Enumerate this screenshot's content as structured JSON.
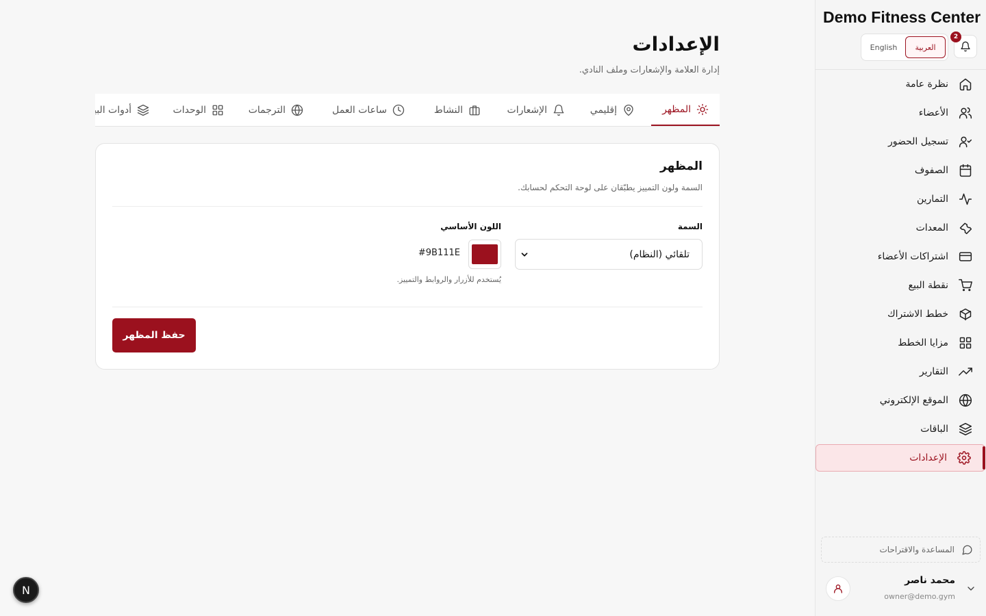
{
  "brand": {
    "name": "Demo Fitness Center"
  },
  "header": {
    "notifications_count": "2",
    "lang_arabic": "العربية",
    "lang_english": "English",
    "active_lang": "ar"
  },
  "sidebar": {
    "items": [
      {
        "label": "نظرة عامة",
        "icon": "home-icon"
      },
      {
        "label": "الأعضاء",
        "icon": "users-icon"
      },
      {
        "label": "تسجيل الحضور",
        "icon": "user-check-icon"
      },
      {
        "label": "الصفوف",
        "icon": "calendar-icon"
      },
      {
        "label": "التمارين",
        "icon": "activity-icon"
      },
      {
        "label": "المعدات",
        "icon": "wrench-icon"
      },
      {
        "label": "اشتراكات الأعضاء",
        "icon": "credit-card-icon"
      },
      {
        "label": "نقطة البيع",
        "icon": "cart-icon"
      },
      {
        "label": "خطط الاشتراك",
        "icon": "package-icon"
      },
      {
        "label": "مزايا الخطط",
        "icon": "grid-icon"
      },
      {
        "label": "التقارير",
        "icon": "trending-up-icon"
      },
      {
        "label": "الموقع الإلكتروني",
        "icon": "globe-icon"
      },
      {
        "label": "الباقات",
        "icon": "layers-icon"
      },
      {
        "label": "الإعدادات",
        "icon": "gear-icon",
        "active": true
      }
    ],
    "help_label": "المساعدة والاقتراحات",
    "user": {
      "name": "محمد ناصر",
      "email": "owner@demo.gym"
    }
  },
  "page": {
    "title": "الإعدادات",
    "subtitle": "إدارة العلامة والإشعارات وملف النادي."
  },
  "tabs": [
    {
      "label": "المظهر",
      "icon": "sun-icon",
      "active": true
    },
    {
      "label": "إقليمي",
      "icon": "map-pin-icon"
    },
    {
      "label": "الإشعارات",
      "icon": "bell-icon"
    },
    {
      "label": "النشاط",
      "icon": "briefcase-icon"
    },
    {
      "label": "ساعات العمل",
      "icon": "clock-icon"
    },
    {
      "label": "الترجمات",
      "icon": "globe-icon"
    },
    {
      "label": "الوحدات",
      "icon": "grid-icon"
    },
    {
      "label": "أدوات البيانات",
      "icon": "layers-icon"
    }
  ],
  "appearance": {
    "card_title": "المظهر",
    "card_desc": "السمة ولون التمييز يطبّقان على لوحة التحكم لحسابك.",
    "theme_label": "السمة",
    "theme_value": "تلقائي (النظام)",
    "color_label": "اللون الأساسي",
    "color_value": "#9B111E",
    "color_help": "يُستخدم للأزرار والروابط والتمييز.",
    "save_label": "حفظ المظهر"
  },
  "colors": {
    "accent": "#9b111e",
    "active_bg": "#fbe6e8"
  },
  "dev_badge": "N"
}
